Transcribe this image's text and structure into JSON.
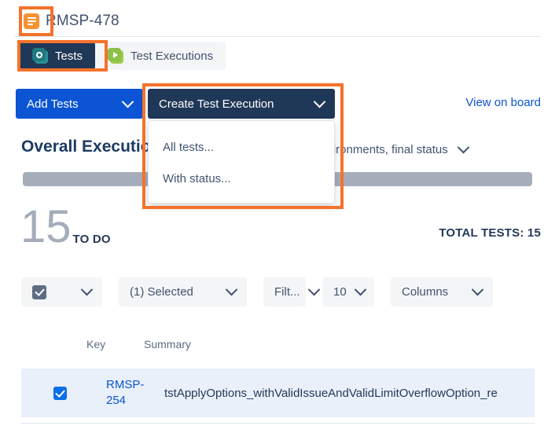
{
  "breadcrumb": {
    "icon": "story-icon",
    "issue_key": "RMSP-478"
  },
  "tabs": [
    {
      "id": "tests",
      "label": "Tests",
      "icon": "tests-icon",
      "active": true
    },
    {
      "id": "test-executions",
      "label": "Test Executions",
      "icon": "play-icon",
      "active": false
    }
  ],
  "actions": {
    "add_tests_label": "Add Tests",
    "create_test_execution_label": "Create Test Execution",
    "view_on_board_label": "View on board"
  },
  "create_menu": {
    "open": true,
    "items": [
      {
        "label": "All tests..."
      },
      {
        "label": "With status..."
      }
    ]
  },
  "overall": {
    "title": "Overall Execution Status",
    "scope_label": "Environments, final status",
    "progress": {
      "todo_percent": 100,
      "todo_color": "#A5ADBA"
    }
  },
  "summary_counts": {
    "todo_count": "15",
    "todo_label": "TO DO",
    "total_tests_label": "TOTAL TESTS: 15"
  },
  "toolbar": {
    "select_all_label": "",
    "selected_label": "(1) Selected",
    "filter_label": "Filt...",
    "rows_per_page": "10",
    "columns_label": "Columns"
  },
  "table": {
    "columns": [
      "Key",
      "Summary"
    ],
    "rows": [
      {
        "checked": true,
        "key": "RMSP-254",
        "summary": "tstApplyOptions_withValidIssueAndValidLimitOverflowOption_re"
      }
    ]
  },
  "annotations": {
    "accent_color": "#F4722B",
    "boxes": [
      "breadcrumb-icon",
      "tests-tab",
      "create-test-execution-menu"
    ]
  }
}
